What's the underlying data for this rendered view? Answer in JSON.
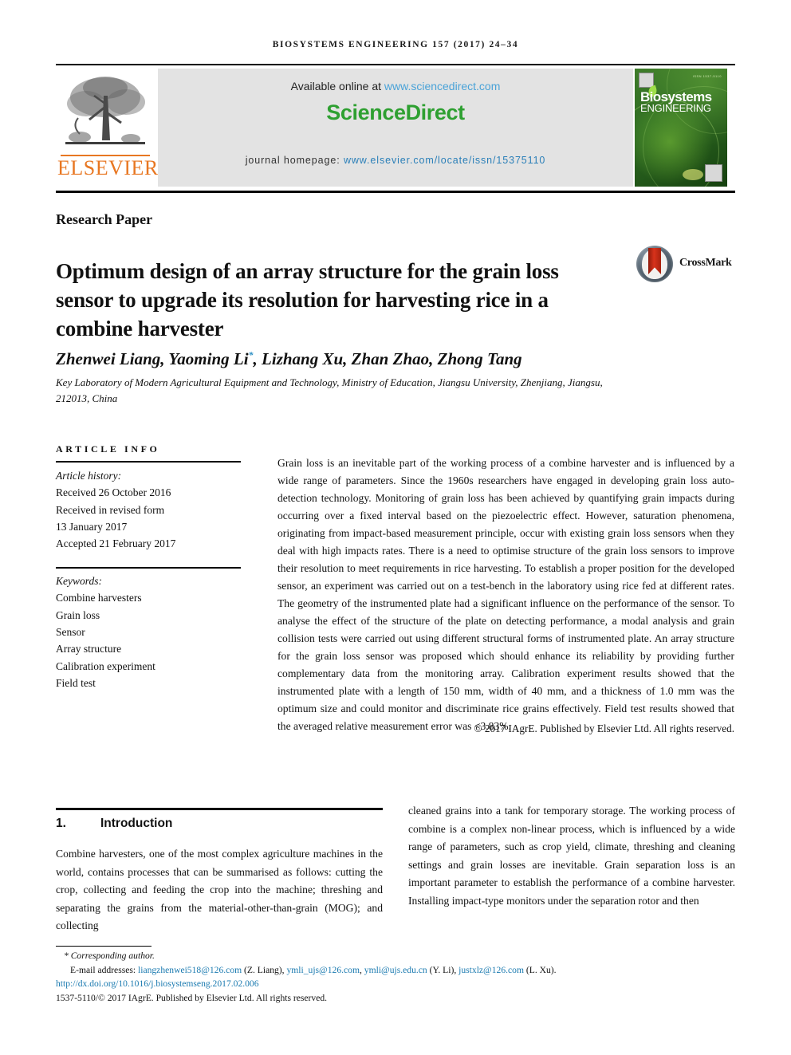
{
  "running_head": "Biosystems Engineering 157 (2017) 24–34",
  "masthead": {
    "publisher_name": "ELSEVIER",
    "available_prefix": "Available online at ",
    "available_url": "www.sciencedirect.com",
    "sciencedirect_logo": "ScienceDirect",
    "homepage_prefix": "journal homepage: ",
    "homepage_url": "www.elsevier.com/locate/issn/15375110",
    "cover": {
      "title_line1": "Biosystems",
      "title_line2": "ENGINEERING",
      "top_text": "ISSN 1537-5110"
    }
  },
  "article": {
    "type": "Research Paper",
    "title": "Optimum design of an array structure for the grain loss sensor to upgrade its resolution for harvesting rice in a combine harvester",
    "crossmark_label": "CrossMark",
    "authors": "Zhenwei Liang, Yaoming Li",
    "authors_suffix": ", Lizhang Xu, Zhan Zhao, Zhong Tang",
    "corresponding_marker": "*",
    "affiliation": "Key Laboratory of Modern Agricultural Equipment and Technology, Ministry of Education, Jiangsu University, Zhenjiang, Jiangsu, 212013, China"
  },
  "article_info": {
    "heading": "ARTICLE INFO",
    "history_label": "Article history:",
    "history": [
      "Received 26 October 2016",
      "Received in revised form",
      "13 January 2017",
      "Accepted 21 February 2017"
    ],
    "keywords_label": "Keywords:",
    "keywords": [
      "Combine harvesters",
      "Grain loss",
      "Sensor",
      "Array structure",
      "Calibration experiment",
      "Field test"
    ]
  },
  "abstract": {
    "text": "Grain loss is an inevitable part of the working process of a combine harvester and is influenced by a wide range of parameters. Since the 1960s researchers have engaged in developing grain loss auto-detection technology. Monitoring of grain loss has been achieved by quantifying grain impacts during occurring over a fixed interval based on the piezoelectric effect. However, saturation phenomena, originating from impact-based measurement principle, occur with existing grain loss sensors when they deal with high impacts rates. There is a need to optimise structure of the grain loss sensors to improve their resolution to meet requirements in rice harvesting. To establish a proper position for the developed sensor, an experiment was carried out on a test-bench in the laboratory using rice fed at different rates. The geometry of the instrumented plate had a significant influence on the performance of the sensor. To analyse the effect of the structure of the plate on detecting performance, a modal analysis and grain collision tests were carried out using different structural forms of instrumented plate. An array structure for the grain loss sensor was proposed which should enhance its reliability by providing further complementary data from the monitoring array. Calibration experiment results showed that the instrumented plate with a length of 150 mm, width of 40 mm, and a thickness of 1.0 mm was the optimum size and could monitor and discriminate rice grains effectively. Field test results showed that the averaged relative measurement error was <3.83%.",
    "copyright": "© 2017 IAgrE. Published by Elsevier Ltd. All rights reserved."
  },
  "introduction": {
    "number": "1.",
    "heading": "Introduction",
    "left_column": "Combine harvesters, one of the most complex agriculture machines in the world, contains processes that can be summarised as follows: cutting the crop, collecting and feeding the crop into the machine; threshing and separating the grains from the material-other-than-grain (MOG); and collecting",
    "right_column": "cleaned grains into a tank for temporary storage. The working process of combine is a complex non-linear process, which is influenced by a wide range of parameters, such as crop yield, climate, threshing and cleaning settings and grain losses are inevitable. Grain separation loss is an important parameter to establish the performance of a combine harvester. Installing impact-type monitors under the separation rotor and then"
  },
  "footnote": {
    "corresponding": "* Corresponding author.",
    "emails_label": "E-mail addresses: ",
    "email1": "liangzhenwei518@126.com",
    "email1_attr": " (Z. Liang), ",
    "email2": "ymli_ujs@126.com",
    "email2_sep": ", ",
    "email3": "ymli@ujs.edu.cn",
    "email3_attr": " (Y. Li), ",
    "email4": "justxlz@126.com",
    "email4_attr": " (L. Xu).",
    "doi": "http://dx.doi.org/10.1016/j.biosystemseng.2017.02.006",
    "issn_line": "1537-5110/© 2017 IAgrE. Published by Elsevier Ltd. All rights reserved."
  },
  "colors": {
    "elsevier_orange": "#E87722",
    "sciencedirect_green": "#2EA031",
    "link_blue": "#1a7ab0",
    "cover_green": "#2d6b22"
  }
}
